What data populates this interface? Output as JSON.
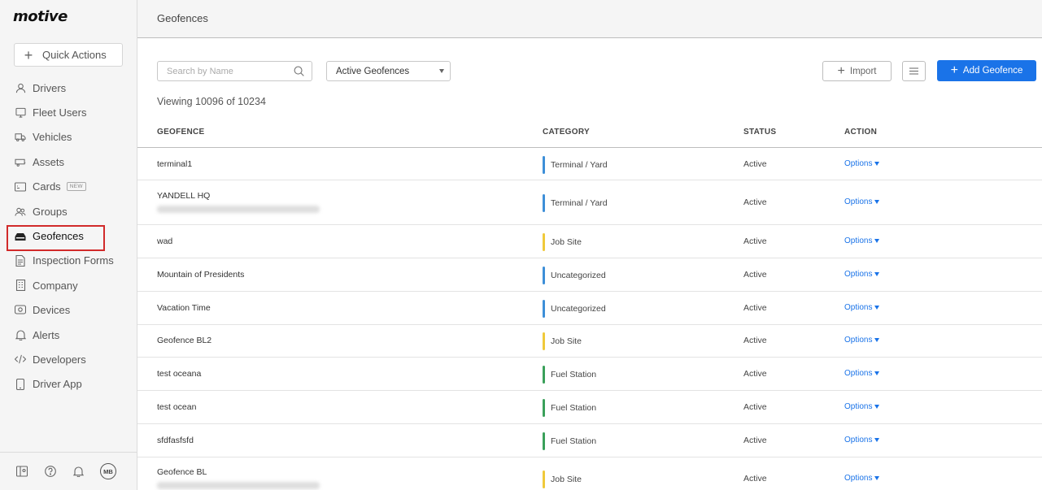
{
  "app": {
    "logo": "motive"
  },
  "sidebar": {
    "quick_actions": "Quick Actions",
    "items": [
      {
        "label": "Drivers",
        "icon": "person-icon"
      },
      {
        "label": "Fleet Users",
        "icon": "monitor-icon"
      },
      {
        "label": "Vehicles",
        "icon": "truck-icon"
      },
      {
        "label": "Assets",
        "icon": "trailer-icon"
      },
      {
        "label": "Cards",
        "icon": "card-icon",
        "badge": "NEW"
      },
      {
        "label": "Groups",
        "icon": "groups-icon"
      },
      {
        "label": "Geofences",
        "icon": "geofence-icon",
        "active": true
      },
      {
        "label": "Inspection Forms",
        "icon": "document-icon"
      },
      {
        "label": "Company",
        "icon": "building-icon"
      },
      {
        "label": "Devices",
        "icon": "device-icon"
      },
      {
        "label": "Alerts",
        "icon": "bell-icon"
      },
      {
        "label": "Developers",
        "icon": "code-icon"
      },
      {
        "label": "Driver App",
        "icon": "phone-icon"
      }
    ],
    "footer": {
      "avatar_initials": "MB"
    }
  },
  "header": {
    "title": "Geofences"
  },
  "toolbar": {
    "search_placeholder": "Search by Name",
    "filter_selected": "Active Geofences",
    "import_label": "Import",
    "add_label": "Add Geofence"
  },
  "viewing_text": "Viewing 10096 of 10234",
  "colors": {
    "accent": "#1a73e8",
    "terminal": "#3d8fd8",
    "job_site": "#f0c93a",
    "fuel": "#3aa05a",
    "uncategorized": "#3d8fd8",
    "highlight": "#d12a2a"
  },
  "table": {
    "columns": [
      "GEOFENCE",
      "CATEGORY",
      "STATUS",
      "ACTION"
    ],
    "rows": [
      {
        "name": "terminal1",
        "category": "Terminal / Yard",
        "status": "Active",
        "action": "Options",
        "color": "#3d8fd8",
        "blurred_address": false
      },
      {
        "name": "YANDELL HQ",
        "category": "Terminal / Yard",
        "status": "Active",
        "action": "Options",
        "color": "#3d8fd8",
        "blurred_address": true
      },
      {
        "name": "wad",
        "category": "Job Site",
        "status": "Active",
        "action": "Options",
        "color": "#f0c93a",
        "blurred_address": false
      },
      {
        "name": "Mountain of Presidents",
        "category": "Uncategorized",
        "status": "Active",
        "action": "Options",
        "color": "#3d8fd8",
        "blurred_address": false
      },
      {
        "name": "Vacation Time",
        "category": "Uncategorized",
        "status": "Active",
        "action": "Options",
        "color": "#3d8fd8",
        "blurred_address": false
      },
      {
        "name": "Geofence BL2",
        "category": "Job Site",
        "status": "Active",
        "action": "Options",
        "color": "#f0c93a",
        "blurred_address": false
      },
      {
        "name": "test oceana",
        "category": "Fuel Station",
        "status": "Active",
        "action": "Options",
        "color": "#3aa05a",
        "blurred_address": false
      },
      {
        "name": "test ocean",
        "category": "Fuel Station",
        "status": "Active",
        "action": "Options",
        "color": "#3aa05a",
        "blurred_address": false
      },
      {
        "name": "sfdfasfsfd",
        "category": "Fuel Station",
        "status": "Active",
        "action": "Options",
        "color": "#3aa05a",
        "blurred_address": false
      },
      {
        "name": "Geofence BL",
        "category": "Job Site",
        "status": "Active",
        "action": "Options",
        "color": "#f0c93a",
        "blurred_address": true
      }
    ]
  }
}
